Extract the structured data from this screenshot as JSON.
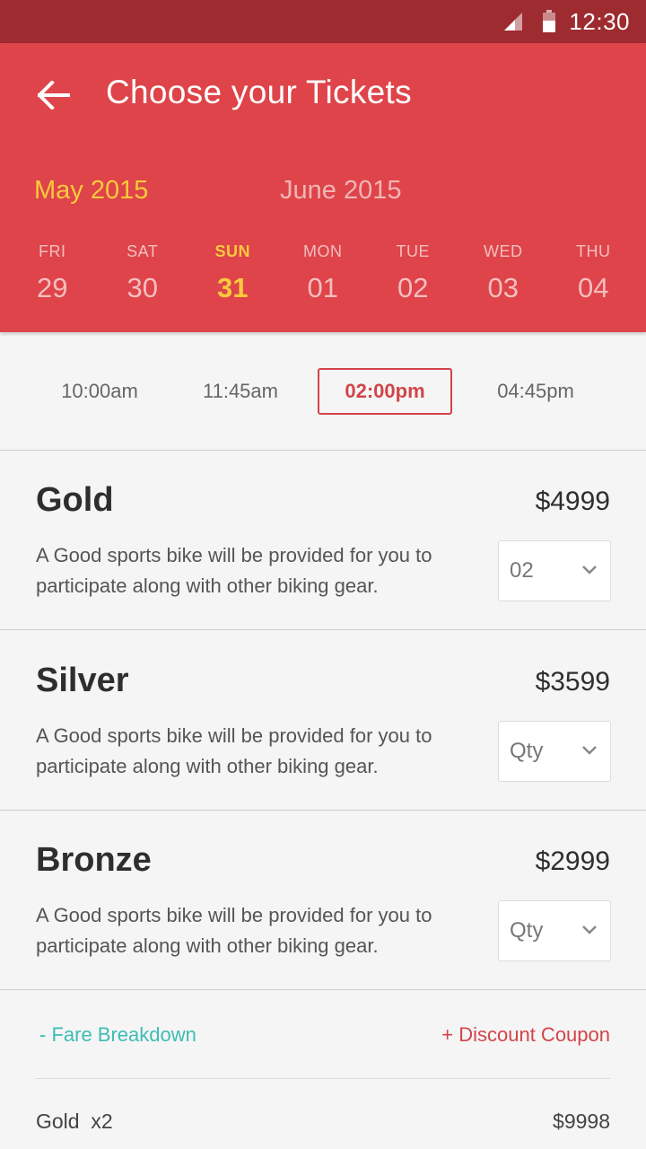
{
  "status_bar": {
    "time": "12:30",
    "signal_icon": "signal-icon",
    "battery_icon": "battery-icon"
  },
  "header": {
    "title": "Choose your Tickets",
    "back_icon": "arrow-left-icon",
    "months": [
      {
        "label": "May 2015",
        "active": true
      },
      {
        "label": "June 2015",
        "active": false
      }
    ],
    "days": [
      {
        "dow": "FRI",
        "num": "29"
      },
      {
        "dow": "SAT",
        "num": "30"
      },
      {
        "dow": "SUN",
        "num": "31",
        "selected": true
      },
      {
        "dow": "MON",
        "num": "01"
      },
      {
        "dow": "TUE",
        "num": "02"
      },
      {
        "dow": "WED",
        "num": "03"
      },
      {
        "dow": "THU",
        "num": "04"
      }
    ]
  },
  "times": [
    {
      "label": "10:00am"
    },
    {
      "label": "11:45am"
    },
    {
      "label": "02:00pm",
      "selected": true
    },
    {
      "label": "04:45pm"
    }
  ],
  "tickets": [
    {
      "name": "Gold",
      "price": "$4999",
      "description": "A Good sports bike will be provided for you to participate along with other biking gear.",
      "qty": "02"
    },
    {
      "name": "Silver",
      "price": "$3599",
      "description": "A Good sports bike will be provided for you to participate along with other biking gear.",
      "qty": "Qty"
    },
    {
      "name": "Bronze",
      "price": "$2999",
      "description": "A Good sports bike will be provided for you to participate along with other biking gear.",
      "qty": "Qty"
    }
  ],
  "links": {
    "fare_breakdown": "- Fare Breakdown",
    "discount_coupon": "+ Discount Coupon"
  },
  "summary": [
    {
      "label": "Gold  x2",
      "value": "$9998"
    }
  ],
  "colors": {
    "status_bar": "#9e2b2f",
    "header": "#de4449",
    "accent_yellow": "#f9c93c",
    "accent_red": "#d24449",
    "accent_teal": "#3cbdb5"
  }
}
